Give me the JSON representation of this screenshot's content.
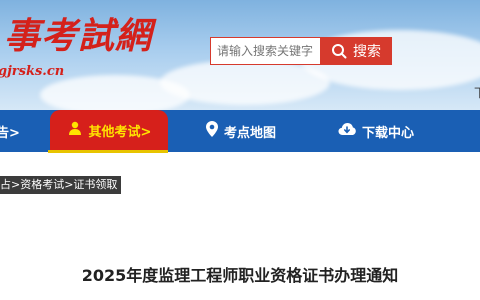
{
  "header": {
    "logo_text": "事考試網",
    "logo_url": "gjrsks.cn",
    "search": {
      "placeholder": "请输入搜索关键字",
      "button_label": "搜索"
    },
    "top_right_clip": "下"
  },
  "nav": {
    "items": [
      {
        "label": "告>",
        "icon": "none"
      },
      {
        "label": "其他考试>",
        "icon": "user-icon",
        "active": true
      },
      {
        "label": "考点地图",
        "icon": "map-pin-icon"
      },
      {
        "label": "下载中心",
        "icon": "cloud-download-icon"
      }
    ],
    "colors": {
      "bar": "#1a5fb4",
      "active_bg": "#d6201b",
      "active_text": "#ffe400"
    }
  },
  "breadcrumb": {
    "text": "占>资格考试>证书领取"
  },
  "article": {
    "title": "2025年度监理工程师职业资格证书办理通知"
  },
  "colors": {
    "brand_red": "#d4211b",
    "search_red": "#d63a2d"
  }
}
